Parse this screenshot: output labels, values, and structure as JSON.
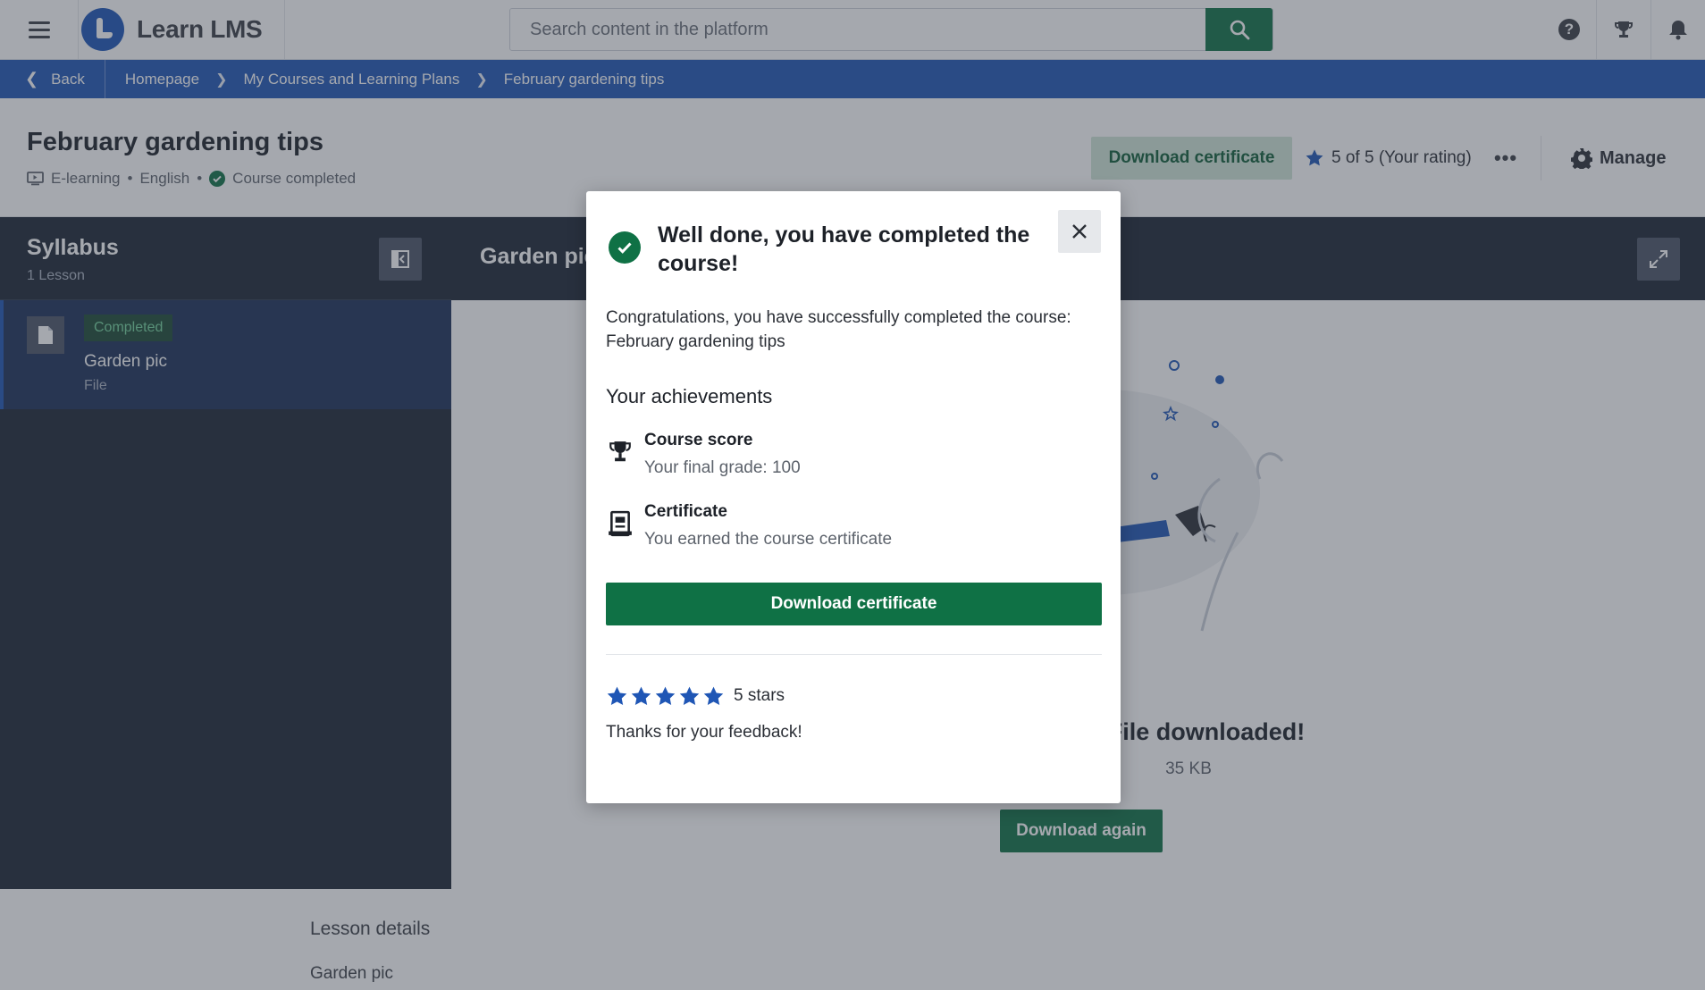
{
  "app": {
    "name": "Learn LMS"
  },
  "search": {
    "placeholder": "Search content in the platform"
  },
  "breadcrumb": {
    "back_label": "Back",
    "items": [
      "Homepage",
      "My Courses and Learning Plans",
      "February gardening tips"
    ]
  },
  "course": {
    "title": "February gardening tips",
    "type": "E-learning",
    "language": "English",
    "status": "Course completed",
    "download_certificate_label": "Download certificate",
    "rating_text": "5 of 5 (Your rating)",
    "more_label": "•••",
    "manage_label": "Manage"
  },
  "syllabus": {
    "title": "Syllabus",
    "count": "1 Lesson",
    "lessons": [
      {
        "badge": "Completed",
        "name": "Garden pic",
        "type": "File"
      }
    ]
  },
  "content": {
    "title": "Garden pic",
    "downloaded_text": "File downloaded!",
    "size_text": "35 KB",
    "download_again_label": "Download again"
  },
  "lesson_details": {
    "title": "Lesson details",
    "name": "Garden pic"
  },
  "modal": {
    "title": "Well done, you have completed the course!",
    "message": "Congratulations, you have successfully completed the course: February gardening tips",
    "achievements_title": "Your achievements",
    "achievements": [
      {
        "name": "Course score",
        "detail": "Your final grade: 100",
        "icon": "trophy-icon"
      },
      {
        "name": "Certificate",
        "detail": "You earned the course certificate",
        "icon": "certificate-icon"
      }
    ],
    "download_label": "Download certificate",
    "rating": 5,
    "rating_label": "5 stars",
    "feedback_text": "Thanks for your feedback!"
  },
  "colors": {
    "brand_blue": "#1f56b5",
    "accent_green": "#0f7145",
    "star_blue": "#1f56b5",
    "sidebar_dark": "#1c2533"
  }
}
